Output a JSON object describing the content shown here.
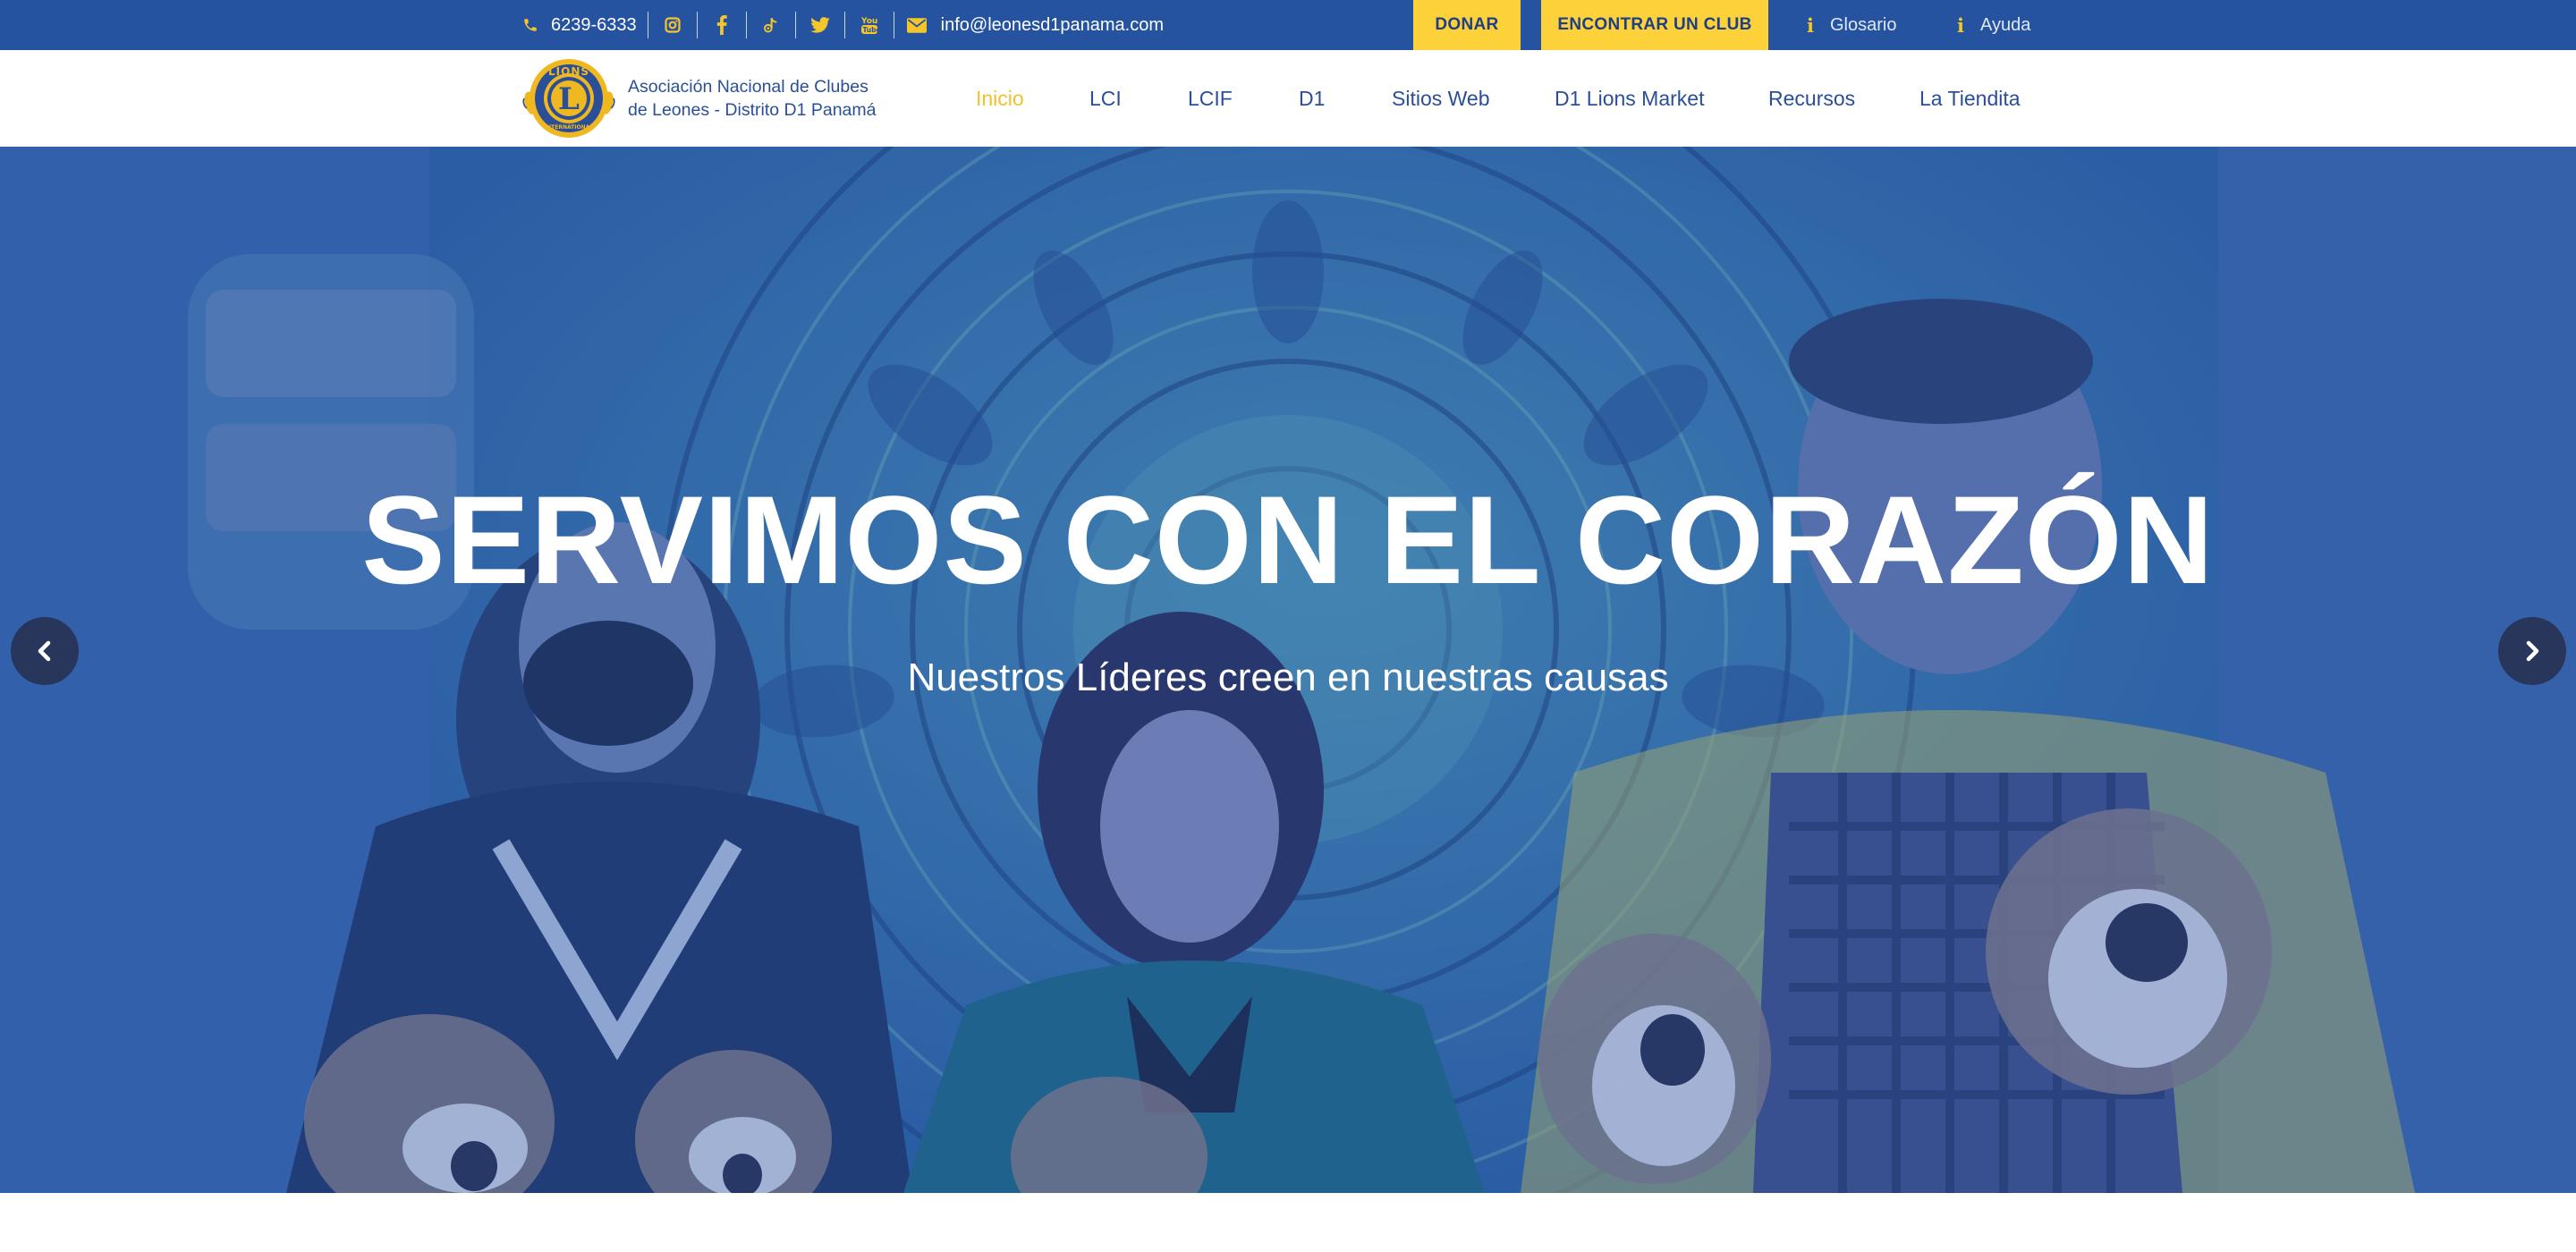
{
  "topbar": {
    "phone": "6239-6333",
    "email": "info@leonesd1panama.com",
    "social_icons": [
      "instagram-icon",
      "facebook-icon",
      "tiktok-icon",
      "twitter-icon",
      "youtube-icon"
    ],
    "donate_label": "DONAR",
    "find_club_label": "ENCONTRAR UN CLUB",
    "glossary_label": "Glosario",
    "help_label": "Ayuda"
  },
  "logo": {
    "emblem_text_top": "LIONS",
    "emblem_text_bottom": "INTERNATIONAL",
    "emblem_letter": "L",
    "line1": "Asociación Nacional de Clubes",
    "line2": "de Leones  - Distrito D1 Panamá"
  },
  "nav": {
    "items": [
      "Inicio",
      "LCI",
      "LCIF",
      "D1",
      "Sitios Web",
      "D1 Lions Market",
      "Recursos",
      "La Tiendita"
    ],
    "active": "Inicio"
  },
  "hero": {
    "title": "SERVIMOS CON EL CORAZÓN",
    "subtitle": "Nuestros Líderes creen en nuestras causas"
  },
  "colors": {
    "topbar_bg": "#2553a0",
    "accent_yellow": "#fcd13a",
    "nav_text": "#2a4f98",
    "nav_active": "#f3c12c",
    "arrow_bg": "#27365a"
  }
}
